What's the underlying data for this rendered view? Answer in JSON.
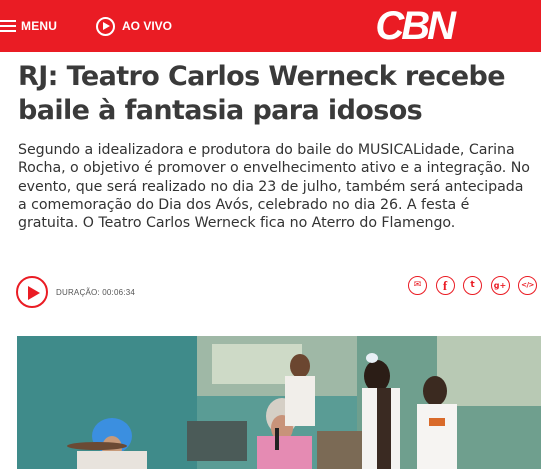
{
  "header": {
    "menu_label": "MENU",
    "live_label": "AO VIVO",
    "logo_text": "CBN",
    "brand_color": "#ea1c24"
  },
  "article": {
    "title": "RJ: Teatro Carlos Werneck recebe baile à fantasia para idosos",
    "summary": "Segundo a idealizadora e produtora do baile do MUSICALidade, Carina Rocha, o objetivo é promover o envelhecimento ativo e a integração. No evento, que será realizado no dia 23 de julho, também será antecipada a comemoração do Dia dos Avós, celebrado no dia 26. A festa é gratuita. O Teatro Carlos Werneck fica no Aterro do Flamengo."
  },
  "player": {
    "duration": "DURAÇÃO: 00:06:34"
  },
  "share": {
    "icons": [
      "email-icon",
      "facebook-icon",
      "twitter-icon",
      "google-plus-icon",
      "embed-icon"
    ],
    "email_glyph": "✉",
    "facebook_glyph": "f",
    "twitter_glyph": "t",
    "googleplus_glyph": "g+",
    "embed_glyph": "</>"
  },
  "video": {
    "description_hidden": false
  }
}
